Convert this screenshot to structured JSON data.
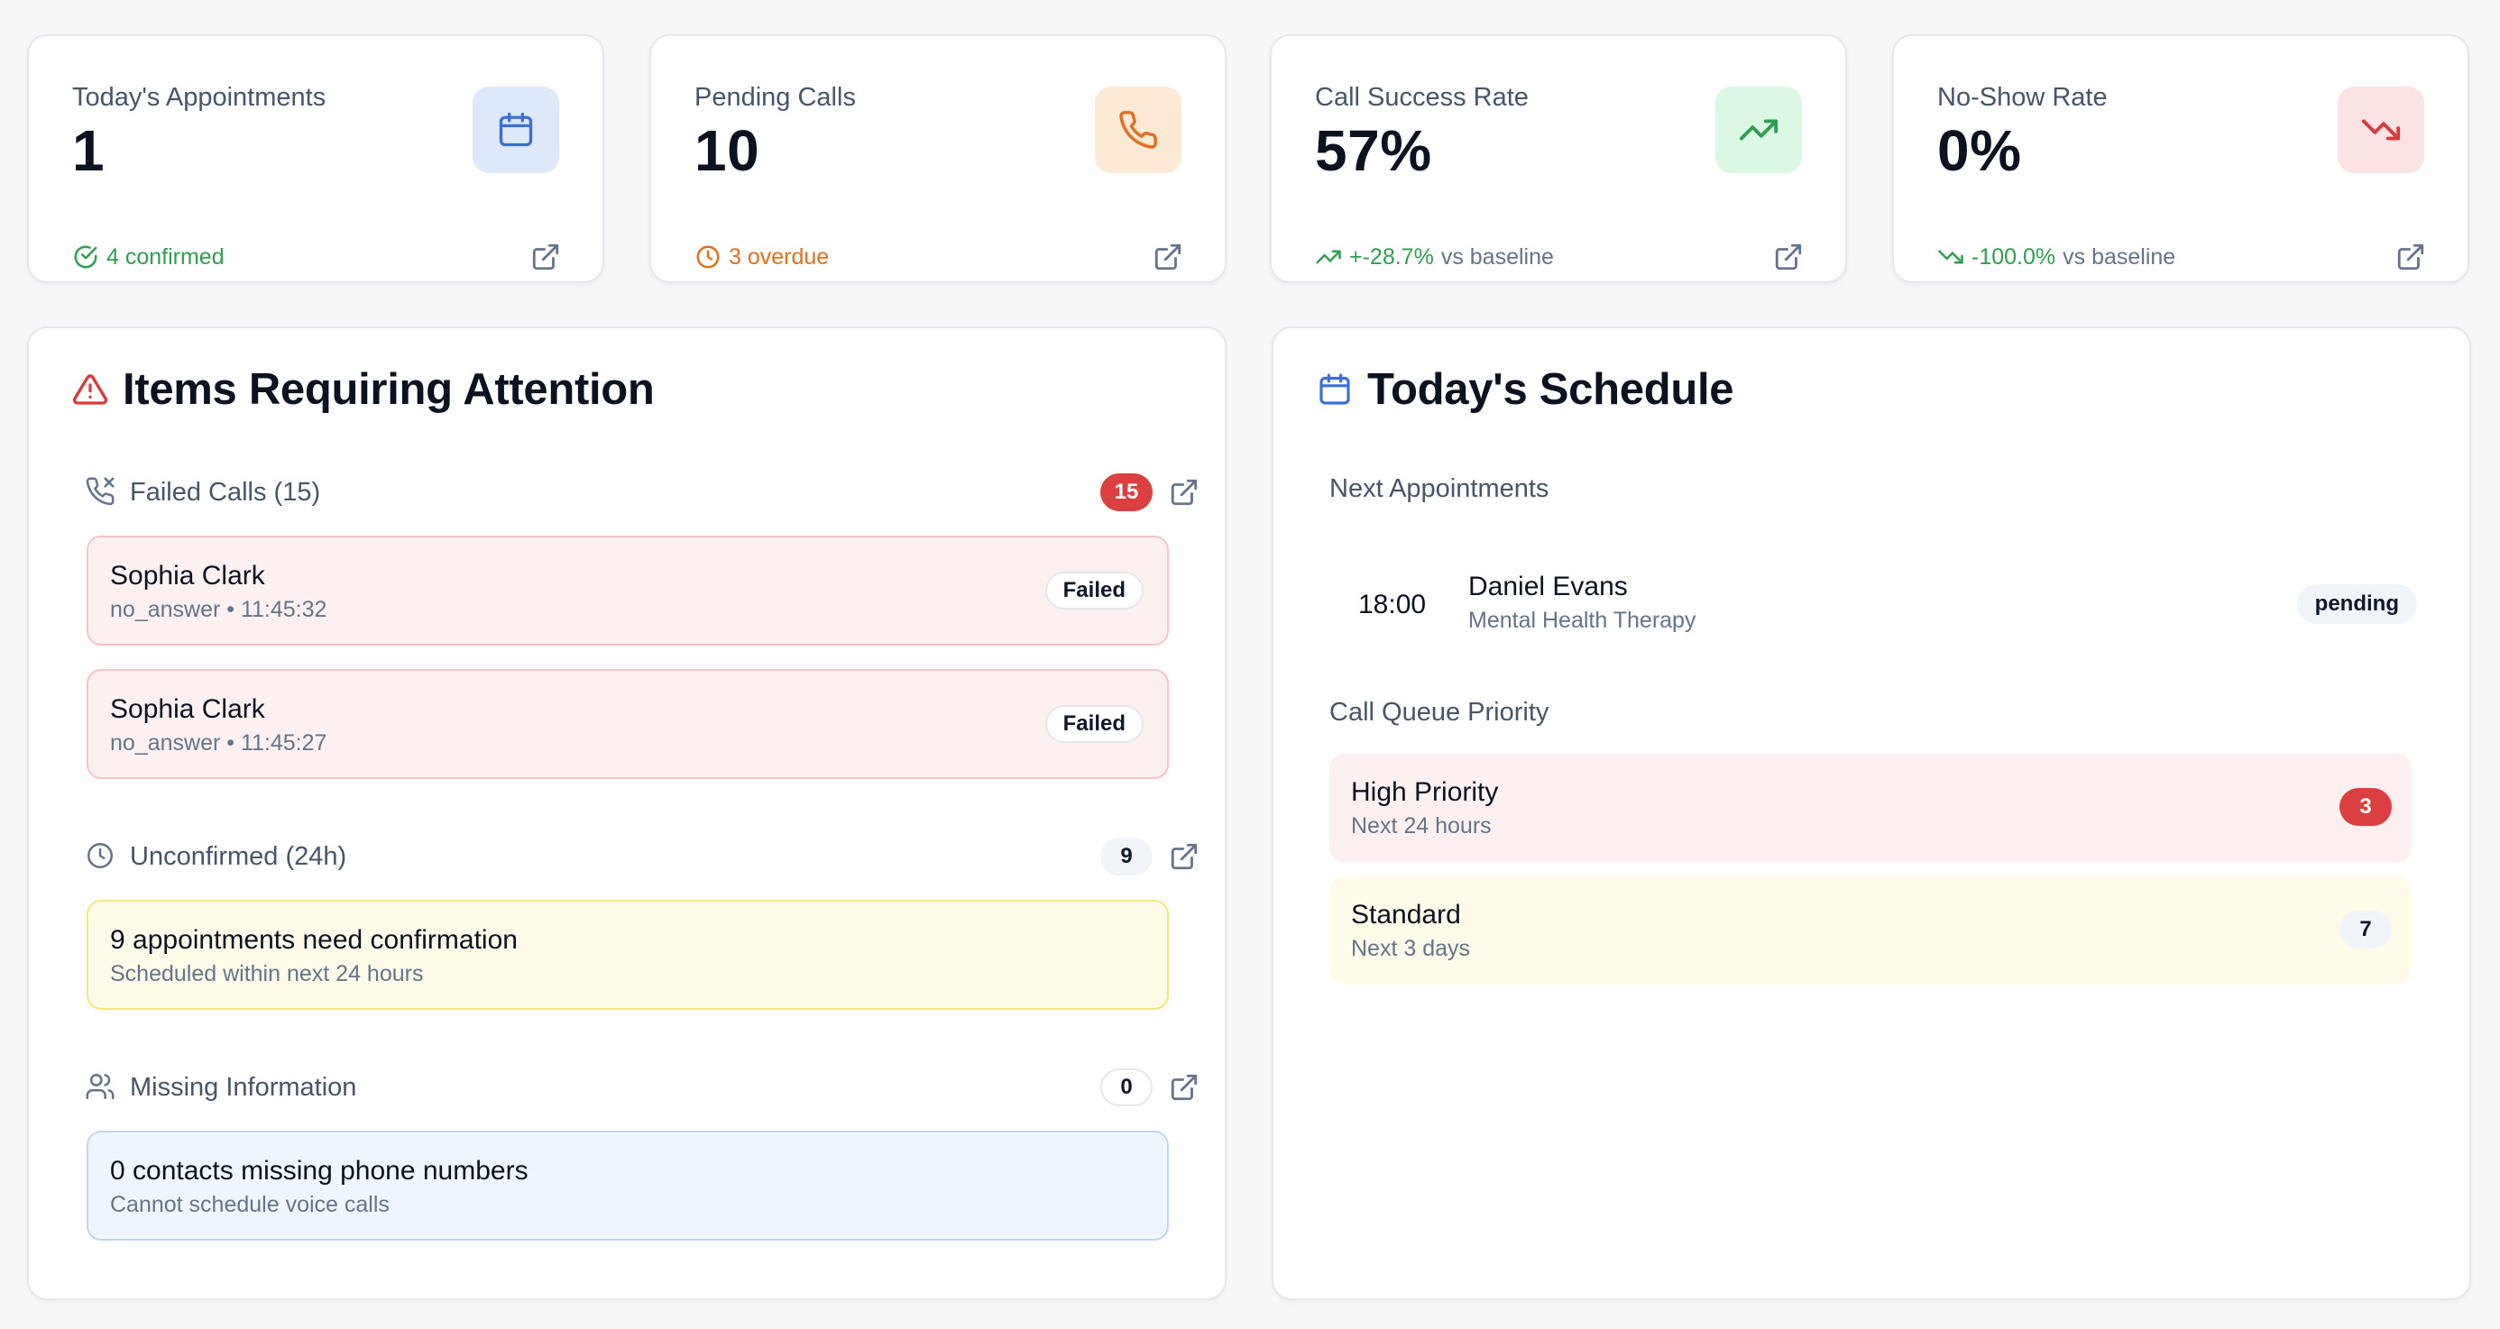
{
  "colors": {
    "blue": "#3b6fd6",
    "orange": "#e0701f",
    "green": "#2f9e4f",
    "red": "#d93a3a",
    "blue_tint": "#dde8fb",
    "orange_tint": "#fde9d5",
    "green_tint": "#dcf7e4",
    "red_tint": "#fbe3e3"
  },
  "stats": [
    {
      "label": "Today's Appointments",
      "value": "1",
      "icon": "calendar-icon",
      "foot_icon": "check-circle-icon",
      "foot_accent": "4 confirmed",
      "foot_text": "",
      "link_icon": "external-link-icon"
    },
    {
      "label": "Pending Calls",
      "value": "10",
      "icon": "phone-icon",
      "foot_icon": "clock-icon",
      "foot_accent": "3 overdue",
      "foot_text": "",
      "link_icon": "external-link-icon"
    },
    {
      "label": "Call Success Rate",
      "value": "57%",
      "icon": "trending-up-icon",
      "foot_icon": "trending-up-icon",
      "foot_accent": "+-28.7%",
      "foot_text": "vs baseline",
      "link_icon": "external-link-icon"
    },
    {
      "label": "No-Show Rate",
      "value": "0%",
      "icon": "trending-down-icon",
      "foot_icon": "trending-down-icon",
      "foot_accent": "-100.0%",
      "foot_text": "vs baseline",
      "link_icon": "external-link-icon"
    }
  ],
  "attention": {
    "title": "Items Requiring Attention",
    "failed": {
      "label": "Failed Calls (15)",
      "count": "15",
      "items": [
        {
          "name": "Sophia Clark",
          "reason": "no_answer",
          "time": "11:45:32",
          "status": "Failed"
        },
        {
          "name": "Sophia Clark",
          "reason": "no_answer",
          "time": "11:45:27",
          "status": "Failed"
        }
      ]
    },
    "unconfirmed": {
      "label": "Unconfirmed (24h)",
      "count": "9",
      "title": "9 appointments need confirmation",
      "subtitle": "Scheduled within next 24 hours"
    },
    "missing": {
      "label": "Missing Information",
      "count": "0",
      "title": "0 contacts missing phone numbers",
      "subtitle": "Cannot schedule voice calls"
    }
  },
  "schedule": {
    "title": "Today's Schedule",
    "next_label": "Next Appointments",
    "appointments": [
      {
        "time": "18:00",
        "name": "Daniel Evans",
        "service": "Mental Health Therapy",
        "status": "pending"
      }
    ],
    "queue_label": "Call Queue Priority",
    "queue": [
      {
        "title": "High Priority",
        "subtitle": "Next 24 hours",
        "count": "3"
      },
      {
        "title": "Standard",
        "subtitle": "Next 3 days",
        "count": "7"
      }
    ]
  }
}
